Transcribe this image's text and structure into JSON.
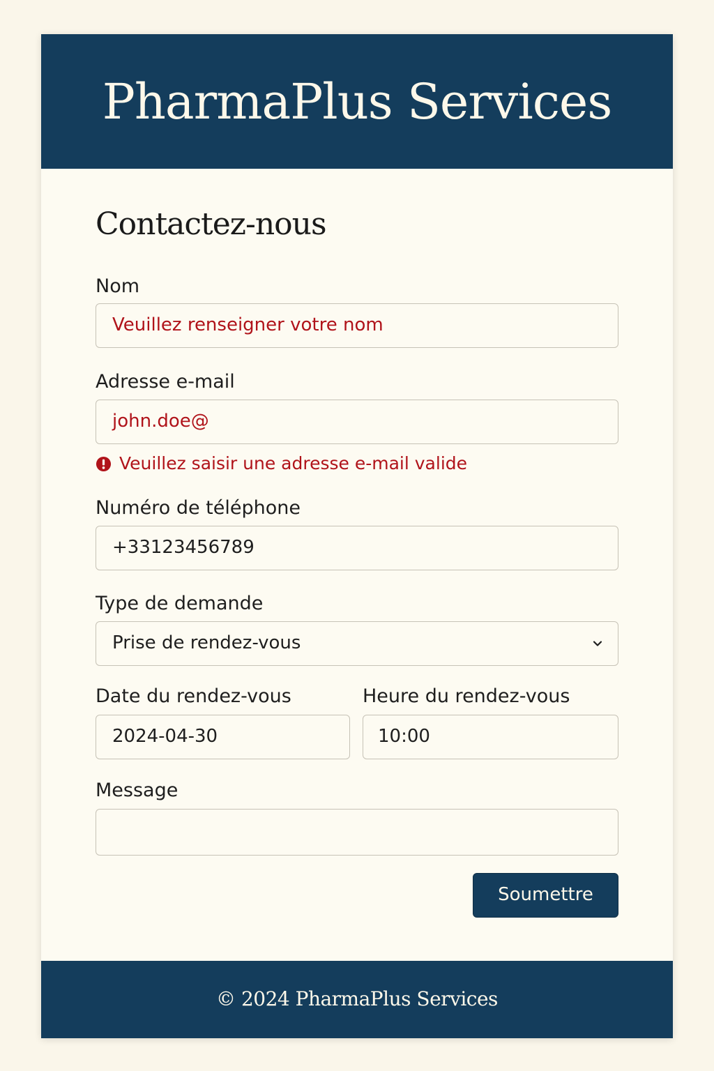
{
  "header": {
    "brand": "PharmaPlus Services"
  },
  "form": {
    "title": "Contactez-nous",
    "name": {
      "label": "Nom",
      "value": "Veuillez renseigner votre nom"
    },
    "email": {
      "label": "Adresse e-mail",
      "value": "john.doe@",
      "error": "Veuillez saisir une adresse e-mail valide"
    },
    "phone": {
      "label": "Numéro de téléphone",
      "value": "+33123456789"
    },
    "request_type": {
      "label": "Type de demande",
      "selected": "Prise de rendez-vous"
    },
    "date": {
      "label": "Date du rendez-vous",
      "value": "2024-04-30"
    },
    "time": {
      "label": "Heure du rendez-vous",
      "value": "10:00"
    },
    "message": {
      "label": "Message",
      "value": ""
    },
    "submit_label": "Soumettre"
  },
  "footer": {
    "text": "© 2024 PharmaPlus Services"
  },
  "colors": {
    "primary": "#143d5c",
    "error": "#b0131a",
    "background": "#faf6ea",
    "card": "#fdfbf2",
    "border": "#c6c2b6"
  },
  "icons": {
    "error": "exclamation-circle-icon",
    "select": "chevron-down-icon"
  }
}
